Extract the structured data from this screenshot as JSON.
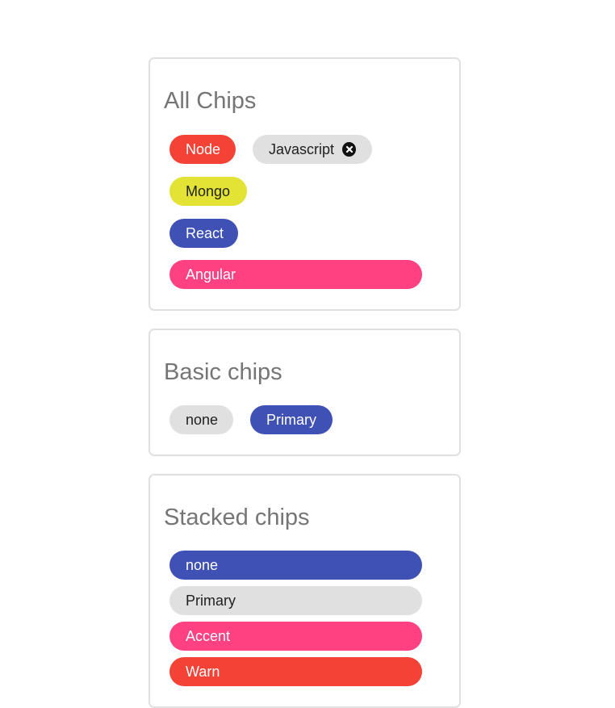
{
  "all_chips": {
    "title": "All Chips",
    "chips": [
      {
        "label": "Node",
        "color": "#f44336"
      },
      {
        "label": "Javascript",
        "color": "#e0e0e0",
        "removable": true,
        "remove_icon": "cancel-icon"
      },
      {
        "label": "Mongo",
        "color": "#e2e334"
      },
      {
        "label": "React",
        "color": "#3f51b5"
      },
      {
        "label": "Angular",
        "color": "#ff4081"
      }
    ]
  },
  "basic_chips": {
    "title": "Basic chips",
    "chips": [
      {
        "label": "none",
        "color": "#e0e0e0"
      },
      {
        "label": "Primary",
        "color": "#3f51b5"
      }
    ]
  },
  "stacked_chips": {
    "title": "Stacked chips",
    "chips": [
      {
        "label": "none",
        "color": "#3f51b5"
      },
      {
        "label": "Primary",
        "color": "#e0e0e0"
      },
      {
        "label": "Accent",
        "color": "#ff4081"
      },
      {
        "label": "Warn",
        "color": "#f44336"
      }
    ]
  }
}
